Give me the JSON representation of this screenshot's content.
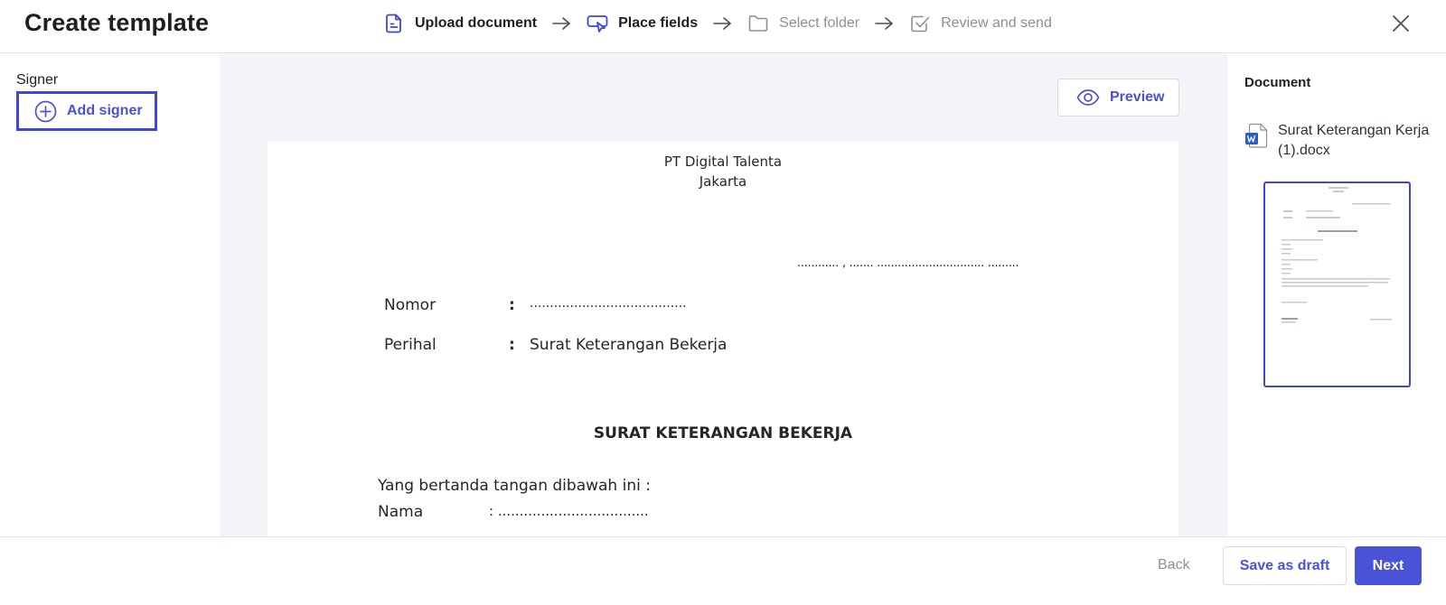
{
  "header": {
    "title": "Create template",
    "steps": [
      {
        "label": "Upload document",
        "state": "active",
        "icon": "document-icon"
      },
      {
        "label": "Place fields",
        "state": "active",
        "icon": "place-fields-icon"
      },
      {
        "label": "Select folder",
        "state": "inactive",
        "icon": "folder-icon"
      },
      {
        "label": "Review and send",
        "state": "inactive",
        "icon": "checkbox-icon"
      }
    ],
    "close_icon": "close-icon"
  },
  "left_panel": {
    "signer_label": "Signer",
    "add_signer_label": "Add signer",
    "add_signer_icon": "plus-circle-icon"
  },
  "center": {
    "preview_label": "Preview",
    "preview_icon": "eye-icon",
    "document": {
      "company": "PT Digital Talenta",
      "city": "Jakarta",
      "date_line": "............ , ....... ............................... .........",
      "fields": [
        {
          "label": "Nomor",
          "colon": ":",
          "value": "......................................."
        },
        {
          "label": "Perihal",
          "colon": ":",
          "value": "Surat Keterangan Bekerja"
        }
      ],
      "heading": "SURAT KETERANGAN BEKERJA",
      "intro": "Yang bertanda tangan dibawah ini :",
      "nama_label": "Nama",
      "nama_value": ":  ..................................."
    }
  },
  "right_panel": {
    "heading": "Document",
    "file_name": "Surat Keterangan Kerja (1).docx",
    "file_icon": "word-file-icon"
  },
  "footer": {
    "back_label": "Back",
    "draft_label": "Save as draft",
    "next_label": "Next"
  },
  "colors": {
    "accent": "#4a52d8",
    "selected_border": "#3f47d6",
    "canvas_bg": "#f3f4f7",
    "inactive_text": "#8a8f98"
  }
}
